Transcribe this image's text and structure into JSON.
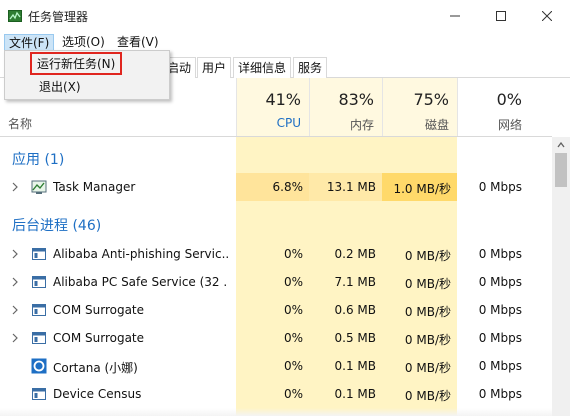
{
  "window": {
    "title": "任务管理器",
    "min_glyph": "—",
    "max_glyph": "☐",
    "close_glyph": "✕"
  },
  "menubar": {
    "file": "文件(F)",
    "options": "选项(O)",
    "view": "查看(V)"
  },
  "file_menu": {
    "run_new_task": "运行新任务(N)",
    "exit": "退出(X)"
  },
  "tabs": {
    "startup": "启动",
    "users": "用户",
    "details": "详细信息",
    "services": "服务"
  },
  "columns": {
    "name": "名称",
    "cpu": {
      "pct": "41%",
      "label": "CPU"
    },
    "memory": {
      "pct": "83%",
      "label": "内存"
    },
    "disk": {
      "pct": "75%",
      "label": "磁盘"
    },
    "network": {
      "pct": "0%",
      "label": "网络"
    }
  },
  "groups": {
    "apps": "应用 (1)",
    "background": "后台进程 (46)"
  },
  "apps": [
    {
      "name": "Task Manager",
      "cpu": "6.8%",
      "memory": "13.1 MB",
      "disk": "1.0 MB/秒",
      "network": "0 Mbps",
      "icon": "task-manager-icon"
    }
  ],
  "background": [
    {
      "name": "Alibaba Anti-phishing Servic...",
      "cpu": "0%",
      "memory": "0.2 MB",
      "disk": "0 MB/秒",
      "network": "0 Mbps",
      "expandable": true
    },
    {
      "name": "Alibaba PC Safe Service (32 ...",
      "cpu": "0%",
      "memory": "7.1 MB",
      "disk": "0 MB/秒",
      "network": "0 Mbps",
      "expandable": true
    },
    {
      "name": "COM Surrogate",
      "cpu": "0%",
      "memory": "0.6 MB",
      "disk": "0 MB/秒",
      "network": "0 Mbps",
      "expandable": true
    },
    {
      "name": "COM Surrogate",
      "cpu": "0%",
      "memory": "0.5 MB",
      "disk": "0 MB/秒",
      "network": "0 Mbps",
      "expandable": true
    },
    {
      "name": "Cortana (小娜)",
      "cpu": "0%",
      "memory": "0.1 MB",
      "disk": "0 MB/秒",
      "network": "0 Mbps",
      "expandable": false
    },
    {
      "name": "Device Census",
      "cpu": "0%",
      "memory": "0.1 MB",
      "disk": "0 MB/秒",
      "network": "0 Mbps",
      "expandable": false
    }
  ],
  "colors": {
    "accent": "#1e6fc4",
    "highlight_border": "#e0261f",
    "heat_light": "#fff4c4",
    "heat_strong": "#ffd96a"
  }
}
